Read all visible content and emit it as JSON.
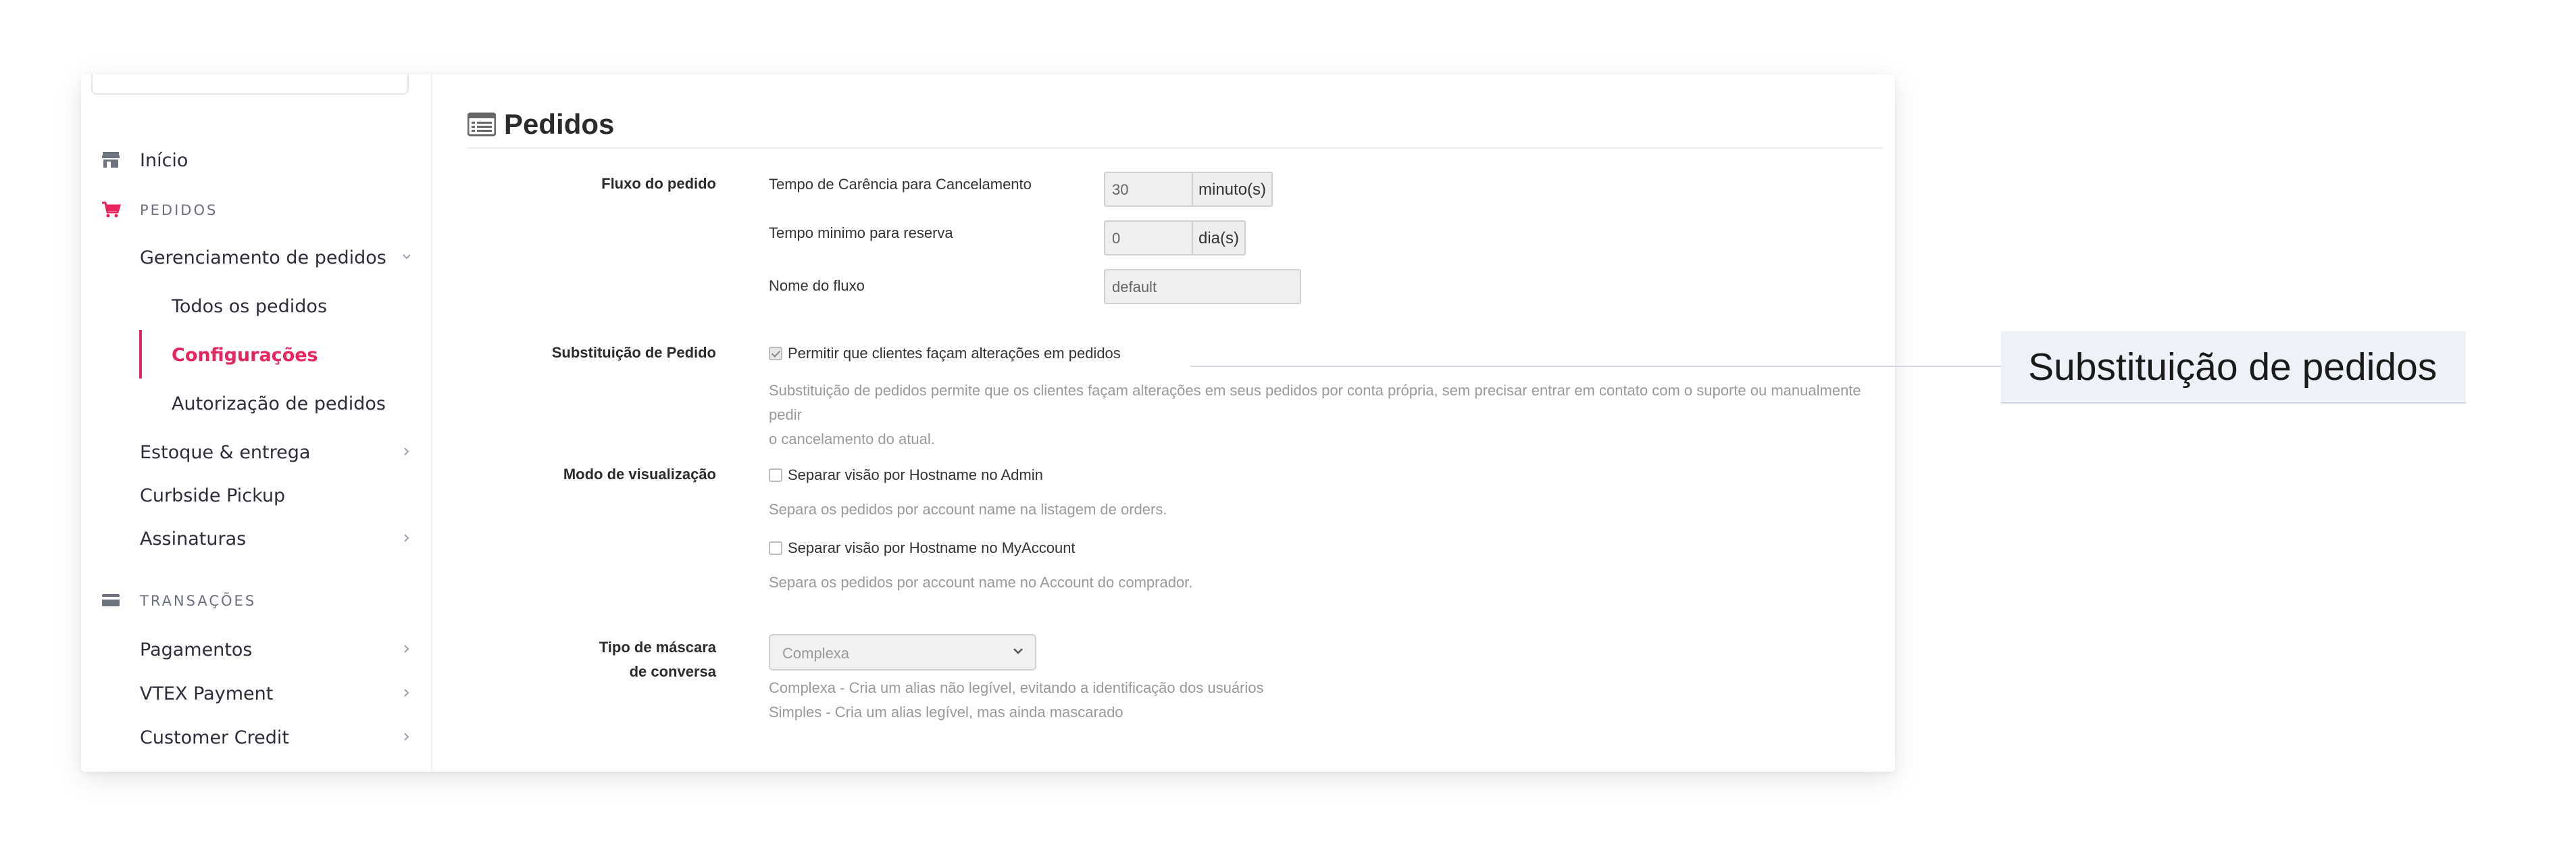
{
  "sidebar": {
    "inicio": "Início",
    "pedidos_section": "PEDIDOS",
    "gerenciamento": "Gerenciamento de pedidos",
    "todos": "Todos os pedidos",
    "configuracoes": "Configurações",
    "autorizacao": "Autorização de pedidos",
    "estoque": "Estoque & entrega",
    "curbside": "Curbside Pickup",
    "assinaturas": "Assinaturas",
    "transacoes_section": "TRANSAÇÕES",
    "pagamentos": "Pagamentos",
    "vtex_payment": "VTEX Payment",
    "customer_credit": "Customer Credit"
  },
  "page": {
    "title": "Pedidos"
  },
  "fluxo": {
    "label": "Fluxo do pedido",
    "carencia_label": "Tempo de Carência para Cancelamento",
    "carencia_value": "30",
    "carencia_unit": "minuto(s)",
    "reserva_label": "Tempo minimo para reserva",
    "reserva_value": "0",
    "reserva_unit": "dia(s)",
    "nome_label": "Nome do fluxo",
    "nome_value": "default"
  },
  "substituicao": {
    "label": "Substituição de Pedido",
    "checkbox_label": "Permitir que clientes façam alterações em pedidos",
    "checked": true,
    "help_line1": "Substituição de pedidos permite que os clientes façam alterações em seus pedidos por conta própria, sem precisar entrar em contato com o suporte ou manualmente pedir",
    "help_line2": "o cancelamento do atual."
  },
  "visualizacao": {
    "label": "Modo de visualização",
    "admin_label": "Separar visão por Hostname no Admin",
    "admin_help": "Separa os pedidos por account name na listagem de orders.",
    "myaccount_label": "Separar visão por Hostname no MyAccount",
    "myaccount_help": "Separa os pedidos por account name no Account do comprador."
  },
  "mascara": {
    "label_line1": "Tipo de máscara",
    "label_line2": "de conversa",
    "selected": "Complexa",
    "help_line1": "Complexa - Cria um alias não legível, evitando a identificação dos usuários",
    "help_line2": "Simples - Cria um alias legível, mas ainda mascarado"
  },
  "callout": {
    "text": "Substituição de pedidos"
  },
  "colors": {
    "accent": "#e8265d",
    "callout_bg": "#eef1f8"
  },
  "icons": [
    "store-icon",
    "cart-icon",
    "credit-card-icon",
    "list-icon",
    "chevron-down-icon",
    "chevron-right-icon"
  ]
}
